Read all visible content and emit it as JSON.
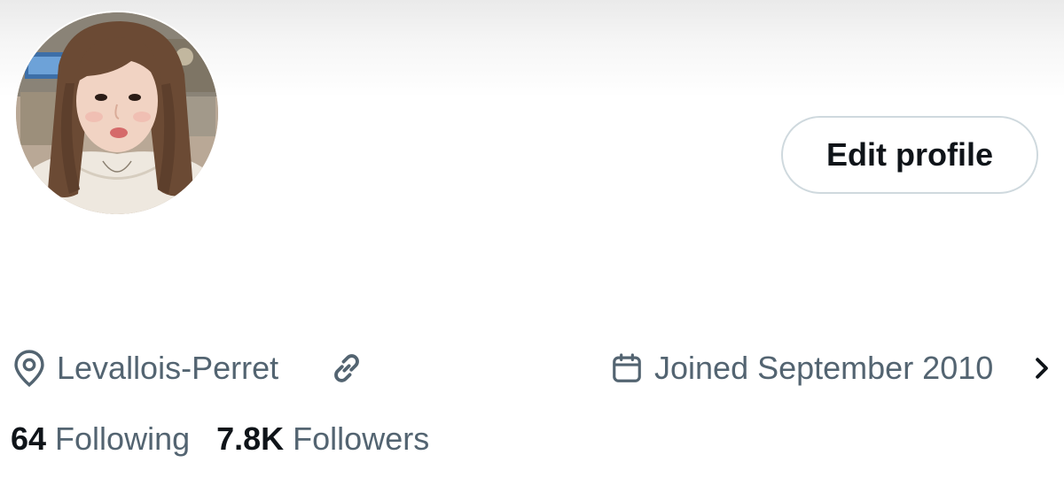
{
  "profile": {
    "avatar_alt": "Profile photo",
    "edit_button_label": "Edit profile"
  },
  "info": {
    "location": "Levallois-Perret",
    "location_icon": "location-pin-icon",
    "link_icon": "link-icon",
    "joined": "Joined September 2010",
    "joined_icon": "calendar-icon"
  },
  "stats": {
    "following_count": "64",
    "following_label": "Following",
    "followers_count": "7.8K",
    "followers_label": "Followers"
  },
  "colors": {
    "text_primary": "#0f1419",
    "text_secondary": "#536471",
    "button_border": "#cfd9de"
  }
}
